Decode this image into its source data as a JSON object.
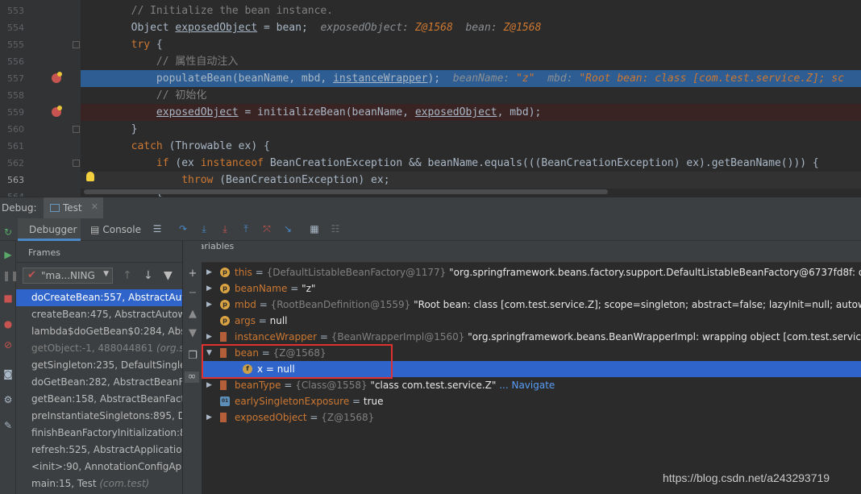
{
  "editor": {
    "lines": [
      {
        "num": "553",
        "code": [
          {
            "t": "        "
          },
          {
            "t": "// Initialize the bean instance.",
            "c": "cm"
          }
        ]
      },
      {
        "num": "554",
        "code": [
          {
            "t": "        Object "
          },
          {
            "t": "exposedObject",
            "c": "ul"
          },
          {
            "t": " = bean;  "
          },
          {
            "t": "exposedObject: ",
            "c": "inl"
          },
          {
            "t": "Z@1568",
            "c": "inlv"
          },
          {
            "t": "  bean: ",
            "c": "inl"
          },
          {
            "t": "Z@1568",
            "c": "inlv"
          }
        ]
      },
      {
        "num": "555",
        "code": [
          {
            "t": "        "
          },
          {
            "t": "try",
            "c": "kw"
          },
          {
            "t": " {"
          }
        ]
      },
      {
        "num": "556",
        "code": [
          {
            "t": "            "
          },
          {
            "t": "// 属性自动注入",
            "c": "cm"
          }
        ]
      },
      {
        "num": "557",
        "code": [
          {
            "t": "            populateBean(beanName, mbd, "
          },
          {
            "t": "instanceWrapper",
            "c": "ul"
          },
          {
            "t": ");  "
          },
          {
            "t": "beanName: ",
            "c": "inl"
          },
          {
            "t": "\"z\"",
            "c": "inlv"
          },
          {
            "t": "  mbd: ",
            "c": "inl"
          },
          {
            "t": "\"Root bean: class [com.test.service.Z]; sc",
            "c": "inlv"
          }
        ],
        "hl": "blue"
      },
      {
        "num": "558",
        "code": [
          {
            "t": "            "
          },
          {
            "t": "// 初始化",
            "c": "cm"
          }
        ]
      },
      {
        "num": "559",
        "code": [
          {
            "t": "            "
          },
          {
            "t": "exposedObject",
            "c": "ul"
          },
          {
            "t": " = initializeBean(beanName, "
          },
          {
            "t": "exposedObject",
            "c": "ul"
          },
          {
            "t": ", mbd);"
          }
        ],
        "hl": "red"
      },
      {
        "num": "560",
        "code": [
          {
            "t": "        }"
          }
        ]
      },
      {
        "num": "561",
        "code": [
          {
            "t": "        "
          },
          {
            "t": "catch",
            "c": "kw"
          },
          {
            "t": " (Throwable ex) {"
          }
        ]
      },
      {
        "num": "562",
        "code": [
          {
            "t": "            "
          },
          {
            "t": "if",
            "c": "kw"
          },
          {
            "t": " (ex "
          },
          {
            "t": "instanceof",
            "c": "kw"
          },
          {
            "t": " BeanCreationException && beanName.equals(((BeanCreationException) ex).getBeanName())) {"
          }
        ]
      },
      {
        "num": "563",
        "code": [
          {
            "t": "                "
          },
          {
            "t": "throw",
            "c": "kw"
          },
          {
            "t": " (BeanCreationException) ex;"
          }
        ],
        "hl": "cur"
      },
      {
        "num": "564",
        "code": [
          {
            "t": "            }"
          }
        ]
      }
    ]
  },
  "debug_bar": {
    "label": "Debug:",
    "tab": "Test"
  },
  "toolbar": {
    "debugger_tab": "Debugger",
    "console_tab": "Console"
  },
  "frames": {
    "header": "Frames",
    "thread": "\"ma...NING",
    "items": [
      {
        "text": "doCreateBean:557, AbstractAuto",
        "sel": true
      },
      {
        "text": "createBean:475, AbstractAutowir"
      },
      {
        "text": "lambda$doGetBean$0:284, Abst"
      },
      {
        "text": "getObject:-1, 488044861 ",
        "italic": "(org.sp",
        "dim": true
      },
      {
        "text": "getSingleton:235, DefaultSinglet"
      },
      {
        "text": "doGetBean:282, AbstractBeanFa"
      },
      {
        "text": "getBean:158, AbstractBeanFacto"
      },
      {
        "text": "preInstantiateSingletons:895, De"
      },
      {
        "text": "finishBeanFactoryInitialization:85"
      },
      {
        "text": "refresh:525, AbstractApplication("
      },
      {
        "text": "<init>:90, AnnotationConfigAppl"
      },
      {
        "text": "main:15, Test ",
        "italic": "(com.test)"
      }
    ]
  },
  "variables": {
    "header": "Variables",
    "rows": [
      {
        "name": "this",
        "eq": " = ",
        "type": "{DefaultListableBeanFactory@1177}",
        "val": " \"org.springframework.beans.factory.support.DefaultListableBeanFactory@6737fd8f: defining",
        "icon": "p",
        "expand": true
      },
      {
        "name": "beanName",
        "eq": " = ",
        "type": "",
        "val": "\"z\"",
        "icon": "p",
        "expand": true
      },
      {
        "name": "mbd",
        "eq": " = ",
        "type": "{RootBeanDefinition@1559}",
        "val": " \"Root bean: class [com.test.service.Z]; scope=singleton; abstract=false; lazyInit=null; autowireMode",
        "icon": "p",
        "expand": true
      },
      {
        "name": "args",
        "eq": " = ",
        "type": "",
        "val": "null",
        "icon": "p",
        "expand": false
      },
      {
        "name": "instanceWrapper",
        "eq": " = ",
        "type": "{BeanWrapperImpl@1560}",
        "val": " \"org.springframework.beans.BeanWrapperImpl: wrapping object [com.test.service.Z@",
        "icon": "s",
        "expand": true
      },
      {
        "name": "bean",
        "eq": " = ",
        "type": "{Z@1568}",
        "val": "",
        "icon": "s",
        "expand": "open"
      },
      {
        "name": "x",
        "eq": " = ",
        "type": "",
        "val": "null",
        "icon": "f",
        "child": true,
        "sel": true
      },
      {
        "name": "beanType",
        "eq": " = ",
        "type": "{Class@1558}",
        "val": " \"class com.test.service.Z\"",
        "nav": "... Navigate",
        "icon": "s",
        "expand": true
      },
      {
        "name": "earlySingletonExposure",
        "eq": " = ",
        "type": "",
        "val": "true",
        "icon": "o",
        "expand": false
      },
      {
        "name": "exposedObject",
        "eq": " = ",
        "type": "{Z@1568}",
        "val": "",
        "icon": "s",
        "expand": true
      }
    ]
  },
  "watermark": "https://blog.csdn.net/a243293719"
}
